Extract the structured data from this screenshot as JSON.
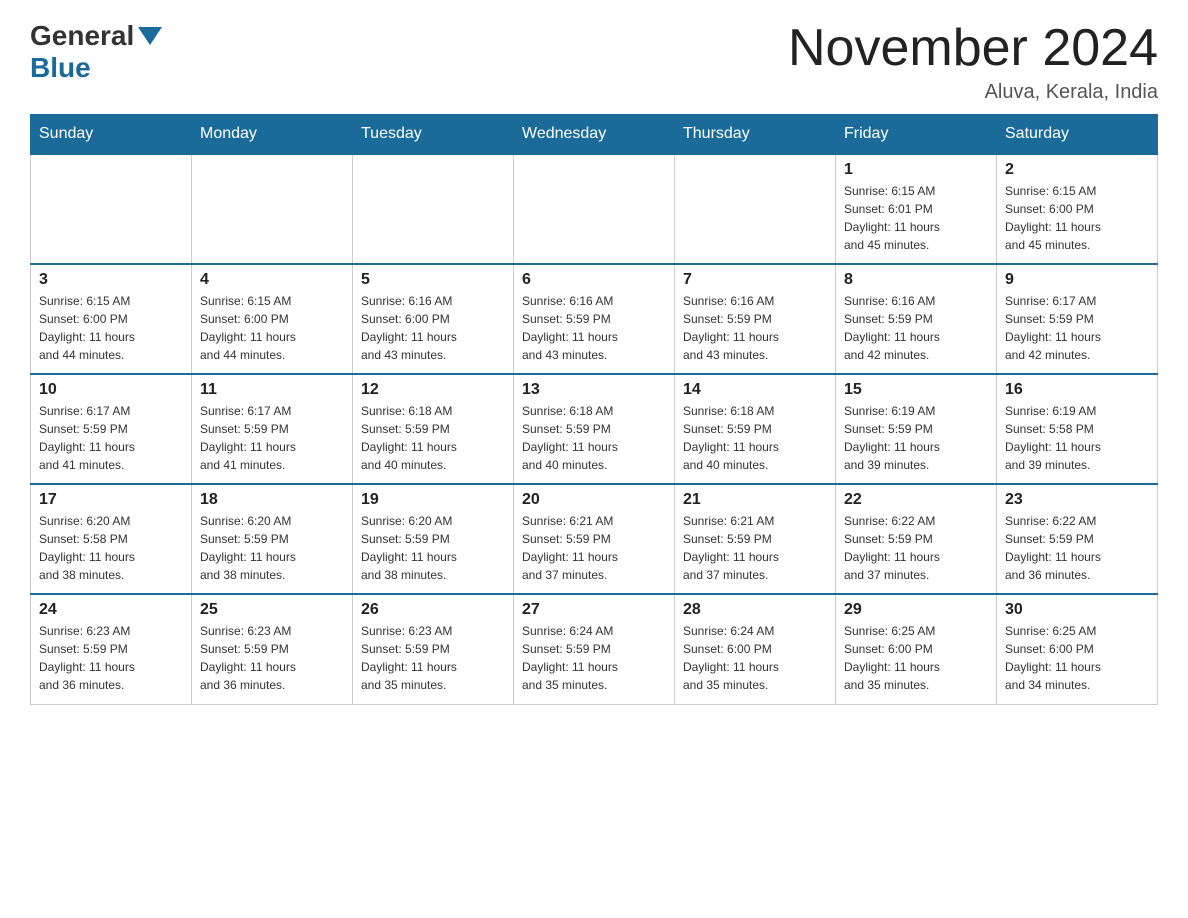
{
  "header": {
    "logo_general": "General",
    "logo_blue": "Blue",
    "month_title": "November 2024",
    "subtitle": "Aluva, Kerala, India"
  },
  "weekdays": [
    "Sunday",
    "Monday",
    "Tuesday",
    "Wednesday",
    "Thursday",
    "Friday",
    "Saturday"
  ],
  "weeks": [
    [
      {
        "day": "",
        "info": ""
      },
      {
        "day": "",
        "info": ""
      },
      {
        "day": "",
        "info": ""
      },
      {
        "day": "",
        "info": ""
      },
      {
        "day": "",
        "info": ""
      },
      {
        "day": "1",
        "info": "Sunrise: 6:15 AM\nSunset: 6:01 PM\nDaylight: 11 hours\nand 45 minutes."
      },
      {
        "day": "2",
        "info": "Sunrise: 6:15 AM\nSunset: 6:00 PM\nDaylight: 11 hours\nand 45 minutes."
      }
    ],
    [
      {
        "day": "3",
        "info": "Sunrise: 6:15 AM\nSunset: 6:00 PM\nDaylight: 11 hours\nand 44 minutes."
      },
      {
        "day": "4",
        "info": "Sunrise: 6:15 AM\nSunset: 6:00 PM\nDaylight: 11 hours\nand 44 minutes."
      },
      {
        "day": "5",
        "info": "Sunrise: 6:16 AM\nSunset: 6:00 PM\nDaylight: 11 hours\nand 43 minutes."
      },
      {
        "day": "6",
        "info": "Sunrise: 6:16 AM\nSunset: 5:59 PM\nDaylight: 11 hours\nand 43 minutes."
      },
      {
        "day": "7",
        "info": "Sunrise: 6:16 AM\nSunset: 5:59 PM\nDaylight: 11 hours\nand 43 minutes."
      },
      {
        "day": "8",
        "info": "Sunrise: 6:16 AM\nSunset: 5:59 PM\nDaylight: 11 hours\nand 42 minutes."
      },
      {
        "day": "9",
        "info": "Sunrise: 6:17 AM\nSunset: 5:59 PM\nDaylight: 11 hours\nand 42 minutes."
      }
    ],
    [
      {
        "day": "10",
        "info": "Sunrise: 6:17 AM\nSunset: 5:59 PM\nDaylight: 11 hours\nand 41 minutes."
      },
      {
        "day": "11",
        "info": "Sunrise: 6:17 AM\nSunset: 5:59 PM\nDaylight: 11 hours\nand 41 minutes."
      },
      {
        "day": "12",
        "info": "Sunrise: 6:18 AM\nSunset: 5:59 PM\nDaylight: 11 hours\nand 40 minutes."
      },
      {
        "day": "13",
        "info": "Sunrise: 6:18 AM\nSunset: 5:59 PM\nDaylight: 11 hours\nand 40 minutes."
      },
      {
        "day": "14",
        "info": "Sunrise: 6:18 AM\nSunset: 5:59 PM\nDaylight: 11 hours\nand 40 minutes."
      },
      {
        "day": "15",
        "info": "Sunrise: 6:19 AM\nSunset: 5:59 PM\nDaylight: 11 hours\nand 39 minutes."
      },
      {
        "day": "16",
        "info": "Sunrise: 6:19 AM\nSunset: 5:58 PM\nDaylight: 11 hours\nand 39 minutes."
      }
    ],
    [
      {
        "day": "17",
        "info": "Sunrise: 6:20 AM\nSunset: 5:58 PM\nDaylight: 11 hours\nand 38 minutes."
      },
      {
        "day": "18",
        "info": "Sunrise: 6:20 AM\nSunset: 5:59 PM\nDaylight: 11 hours\nand 38 minutes."
      },
      {
        "day": "19",
        "info": "Sunrise: 6:20 AM\nSunset: 5:59 PM\nDaylight: 11 hours\nand 38 minutes."
      },
      {
        "day": "20",
        "info": "Sunrise: 6:21 AM\nSunset: 5:59 PM\nDaylight: 11 hours\nand 37 minutes."
      },
      {
        "day": "21",
        "info": "Sunrise: 6:21 AM\nSunset: 5:59 PM\nDaylight: 11 hours\nand 37 minutes."
      },
      {
        "day": "22",
        "info": "Sunrise: 6:22 AM\nSunset: 5:59 PM\nDaylight: 11 hours\nand 37 minutes."
      },
      {
        "day": "23",
        "info": "Sunrise: 6:22 AM\nSunset: 5:59 PM\nDaylight: 11 hours\nand 36 minutes."
      }
    ],
    [
      {
        "day": "24",
        "info": "Sunrise: 6:23 AM\nSunset: 5:59 PM\nDaylight: 11 hours\nand 36 minutes."
      },
      {
        "day": "25",
        "info": "Sunrise: 6:23 AM\nSunset: 5:59 PM\nDaylight: 11 hours\nand 36 minutes."
      },
      {
        "day": "26",
        "info": "Sunrise: 6:23 AM\nSunset: 5:59 PM\nDaylight: 11 hours\nand 35 minutes."
      },
      {
        "day": "27",
        "info": "Sunrise: 6:24 AM\nSunset: 5:59 PM\nDaylight: 11 hours\nand 35 minutes."
      },
      {
        "day": "28",
        "info": "Sunrise: 6:24 AM\nSunset: 6:00 PM\nDaylight: 11 hours\nand 35 minutes."
      },
      {
        "day": "29",
        "info": "Sunrise: 6:25 AM\nSunset: 6:00 PM\nDaylight: 11 hours\nand 35 minutes."
      },
      {
        "day": "30",
        "info": "Sunrise: 6:25 AM\nSunset: 6:00 PM\nDaylight: 11 hours\nand 34 minutes."
      }
    ]
  ]
}
